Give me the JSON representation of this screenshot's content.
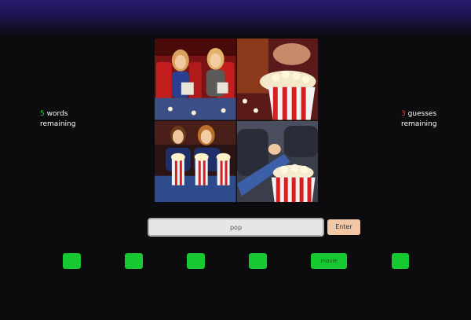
{
  "stats": {
    "words_count": "5",
    "words_label": " words",
    "words_label2": "remaining",
    "guesses_count": "3",
    "guesses_label": " guesses",
    "guesses_label2": "remaining"
  },
  "input": {
    "value": "pop"
  },
  "enter_button": {
    "label": "Enter"
  },
  "word_slots": [
    {
      "text": ""
    },
    {
      "text": ""
    },
    {
      "text": ""
    },
    {
      "text": ""
    },
    {
      "text": "movie"
    },
    {
      "text": ""
    }
  ],
  "colors": {
    "accent_green": "#16c930",
    "count_green": "#2fd23a",
    "count_red": "#ff3b3b",
    "header_purple": "#2a1a6e",
    "enter_peach": "#f2c7a6"
  }
}
